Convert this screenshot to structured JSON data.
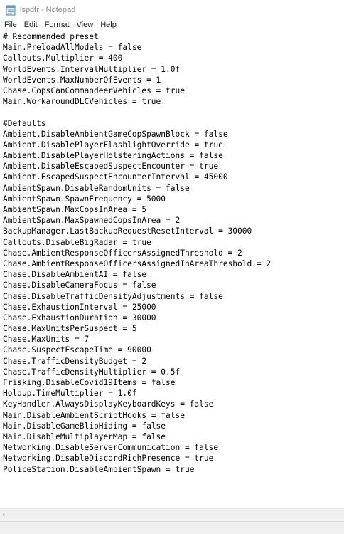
{
  "window": {
    "title": "lspdfr - Notepad",
    "app_icon": "notepad-icon"
  },
  "menu": {
    "items": [
      {
        "label": "File"
      },
      {
        "label": "Edit"
      },
      {
        "label": "Format"
      },
      {
        "label": "View"
      },
      {
        "label": "Help"
      }
    ]
  },
  "editor": {
    "lines": [
      "# Recommended preset",
      "Main.PreloadAllModels = false",
      "Callouts.Multiplier = 400",
      "WorldEvents.IntervalMultiplier = 1.0f",
      "WorldEvents.MaxNumberOfEvents = 1",
      "Chase.CopsCanCommandeerVehicles = true",
      "Main.WorkaroundDLCVehicles = true",
      "",
      "#Defaults",
      "Ambient.DisableAmbientGameCopSpawnBlock = false",
      "Ambient.DisablePlayerFlashlightOverride = true",
      "Ambient.DisablePlayerHolsteringActions = false",
      "Ambient.DisableEscapedSuspectEncounter = true",
      "Ambient.EscapedSuspectEncounterInterval = 45000",
      "AmbientSpawn.DisableRandomUnits = false",
      "AmbientSpawn.SpawnFrequency = 5000",
      "AmbientSpawn.MaxCopsInArea = 5",
      "AmbientSpawn.MaxSpawnedCopsInArea = 2",
      "BackupManager.LastBackupRequestResetInterval = 30000",
      "Callouts.DisableBigRadar = true",
      "Chase.AmbientResponseOfficersAssignedThreshold = 2",
      "Chase.AmbientResponseOfficersAssignedInAreaThreshold = 2",
      "Chase.DisableAmbientAI = false",
      "Chase.DisableCameraFocus = false",
      "Chase.DisableTrafficDensityAdjustments = false",
      "Chase.ExhaustionInterval = 25000",
      "Chase.ExhaustionDuration = 30000",
      "Chase.MaxUnitsPerSuspect = 5",
      "Chase.MaxUnits = 7",
      "Chase.SuspectEscapeTime = 90000",
      "Chase.TrafficDensityBudget = 2",
      "Chase.TrafficDensityMultiplier = 0.5f",
      "Frisking.DisableCovid19Items = false",
      "Holdup.TimeMultiplier = 1.0f",
      "KeyHandler.AlwaysDisplayKeyboardKeys = false",
      "Main.DisableAmbientScriptHooks = false",
      "Main.DisableGameBlipHiding = false",
      "Main.DisableMultiplayerMap = false",
      "Networking.DisableServerCommunication = false",
      "Networking.DisableDiscordRichPresence = true",
      "PoliceStation.DisableAmbientSpawn = true"
    ]
  },
  "scrollbar": {
    "left_arrow": "‹",
    "left_arrow_icon": "chevron-left-icon"
  },
  "colors": {
    "title_text": "#8a8a8a",
    "chrome_bg": "#f0f0f0",
    "text": "#000000"
  }
}
